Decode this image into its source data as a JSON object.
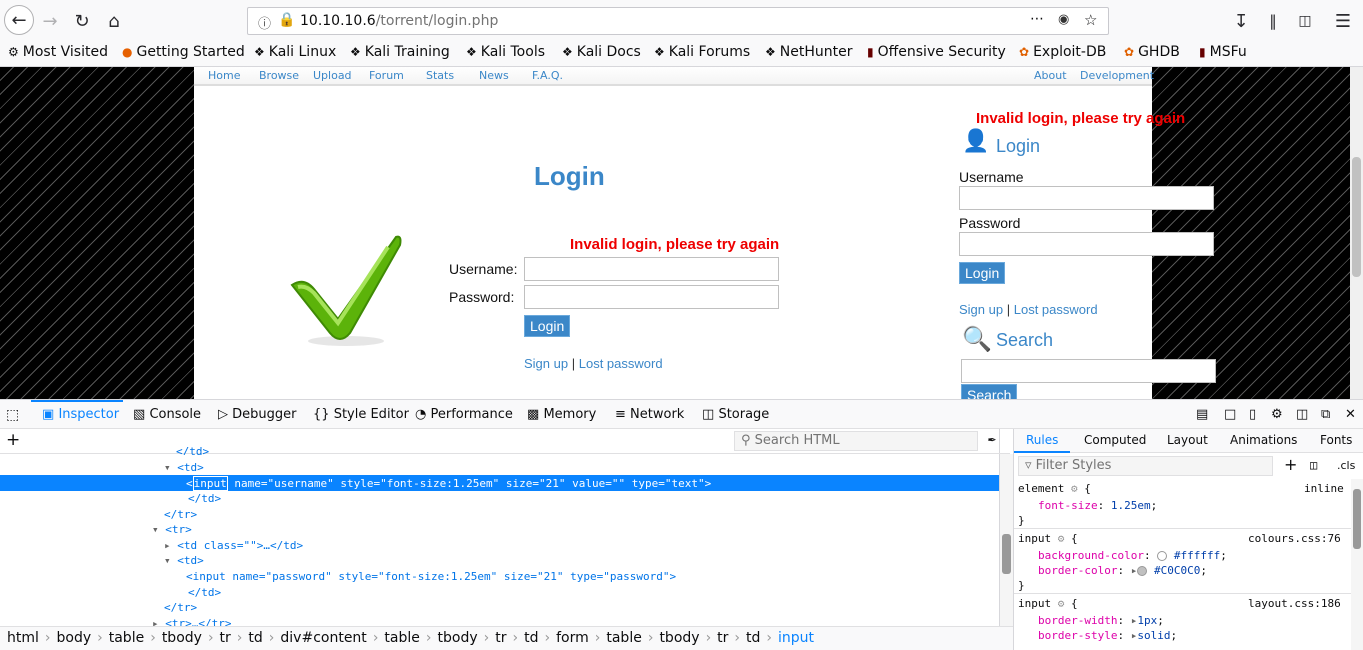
{
  "browser": {
    "url_host": "10.10.10.6",
    "url_path": "/torrent/login.php",
    "bookmarks": [
      "Most Visited",
      "Getting Started",
      "Kali Linux",
      "Kali Training",
      "Kali Tools",
      "Kali Docs",
      "Kali Forums",
      "NetHunter",
      "Offensive Security",
      "Exploit-DB",
      "GHDB",
      "MSFu"
    ]
  },
  "site": {
    "nav": [
      "Home",
      "Browse",
      "Upload",
      "Forum",
      "Stats",
      "News",
      "F.A.Q."
    ],
    "nav_right": [
      "About",
      "Development"
    ],
    "login_title": "Login",
    "error": "Invalid login, please try again",
    "username_label": "Username:",
    "password_label": "Password:",
    "login_button": "Login",
    "signup": "Sign up",
    "pipe": "|",
    "lost_password": "Lost password",
    "side_error": "Invalid login, please try again",
    "side_login_title": "Login",
    "side_username_label": "Username",
    "side_password_label": "Password",
    "side_login_button": "Login",
    "side_signup": "Sign up",
    "side_lost_password": "Lost password",
    "search_title": "Search",
    "search_button": "Search"
  },
  "devtools": {
    "tabs": [
      "Inspector",
      "Console",
      "Debugger",
      "Style Editor",
      "Performance",
      "Memory",
      "Network",
      "Storage"
    ],
    "search_placeholder": "Search HTML",
    "markup": {
      "l0": "</td>",
      "l1": "<td>",
      "l2_tag": "input",
      "l2_attrs": " name=\"username\" style=\"font-size:1.25em\" size=\"21\" value=\"\" type=\"text\">",
      "l3": "</td>",
      "l4": "</tr>",
      "l5": "<tr>",
      "l6": "<td class=\"\">…</td>",
      "l7": "<td>",
      "l8": "<input name=\"password\" style=\"font-size:1.25em\" size=\"21\" type=\"password\">",
      "l9": "</td>",
      "l10": "</tr>",
      "l11": "<tr>…</tr>"
    },
    "breadcrumbs": [
      "html",
      "body",
      "table",
      "tbody",
      "tr",
      "td",
      "div#content",
      "table",
      "tbody",
      "tr",
      "td",
      "form",
      "table",
      "tbody",
      "tr",
      "td",
      "input"
    ],
    "rules_tabs": [
      "Rules",
      "Computed",
      "Layout",
      "Animations",
      "Fonts"
    ],
    "filter_placeholder": "Filter Styles",
    "cls": ".cls",
    "rules": {
      "r1_sel": "element",
      "r1_src": "inline",
      "r1_p1": "font-size",
      "r1_v1": "1.25em",
      "r2_sel": "input",
      "r2_src": "colours.css:76",
      "r2_p1": "background-color",
      "r2_v1": "#ffffff",
      "r2_p2": "border-color",
      "r2_v2": "#C0C0C0",
      "r3_sel": "input",
      "r3_src": "layout.css:186",
      "r3_p1": "border-width",
      "r3_v1": "1px",
      "r3_p2": "border-style",
      "r3_v2": "solid"
    }
  }
}
